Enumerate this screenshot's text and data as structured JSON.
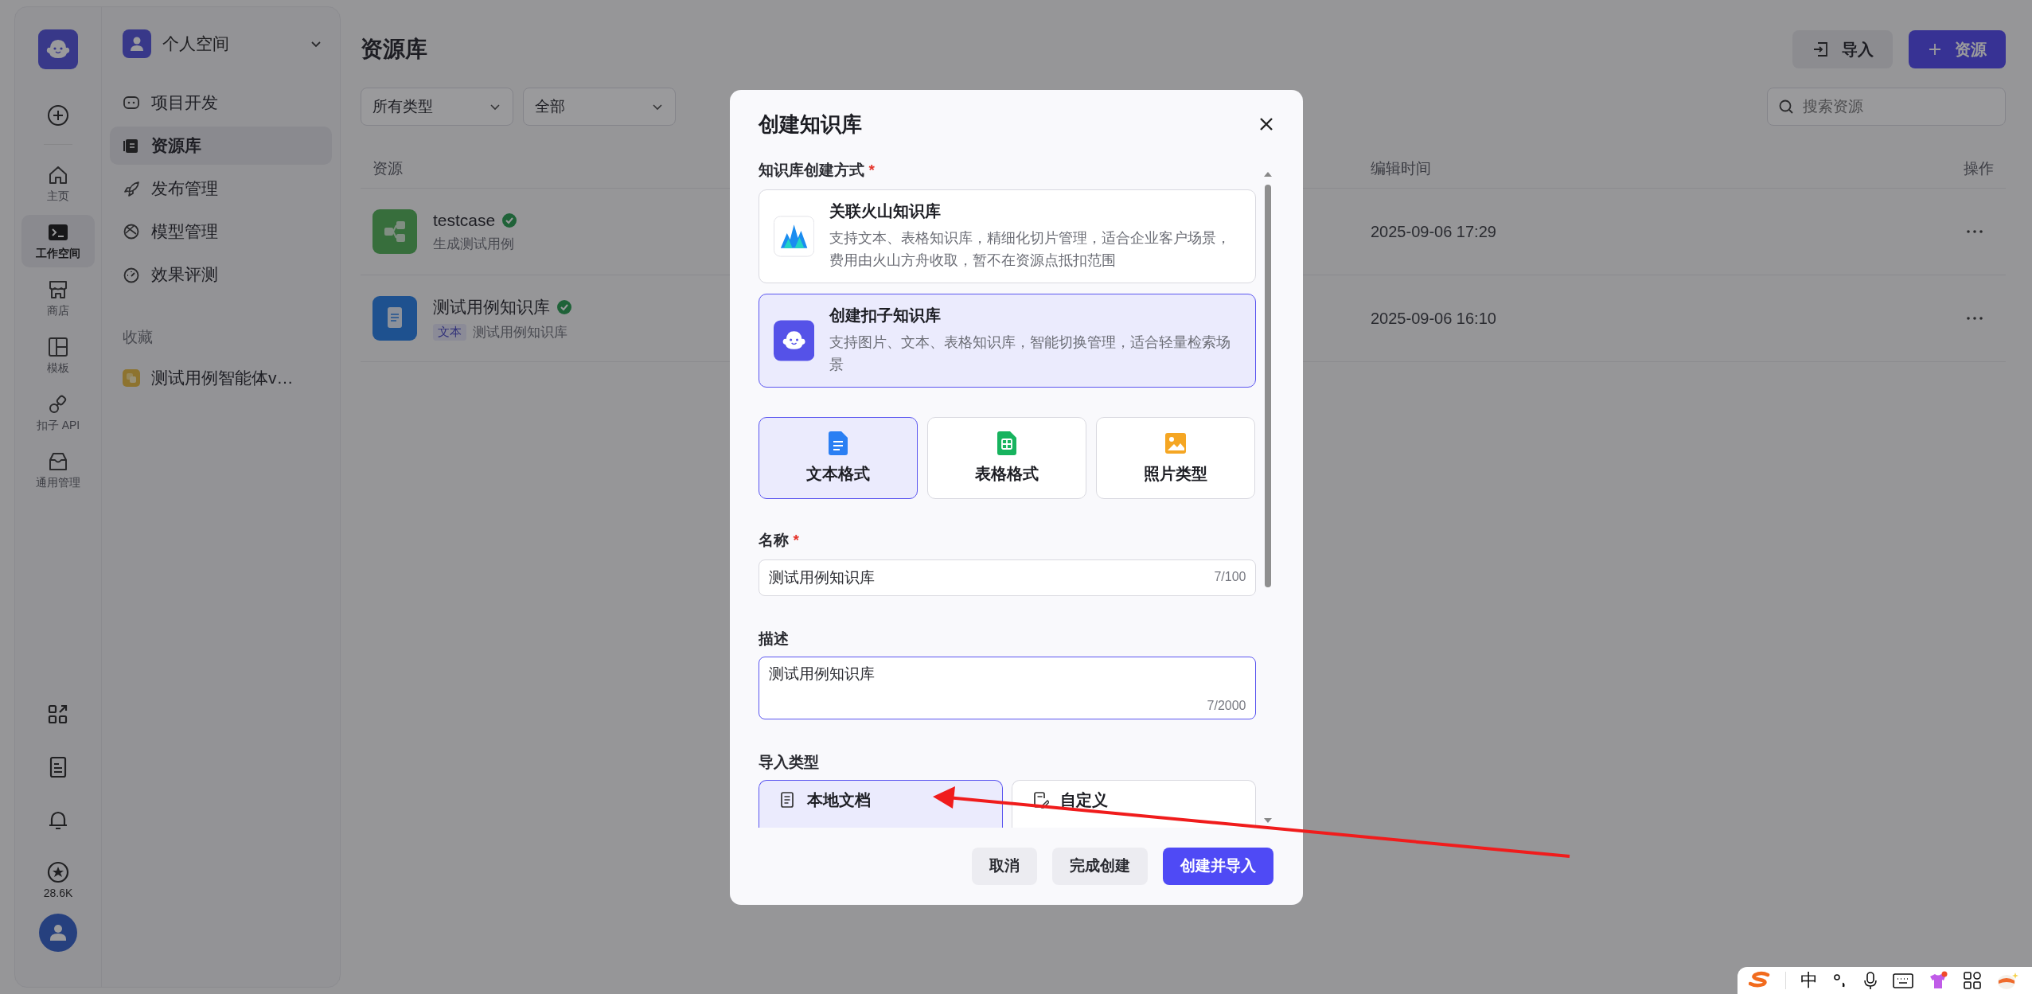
{
  "rail": {
    "items": [
      {
        "label": "主页",
        "selected": false
      },
      {
        "label": "工作空间",
        "selected": true
      },
      {
        "label": "商店",
        "selected": false
      },
      {
        "label": "模板",
        "selected": false
      },
      {
        "label": "扣子 API",
        "selected": false
      },
      {
        "label": "通用管理",
        "selected": false
      }
    ],
    "stars_count": "28.6K"
  },
  "space": {
    "name": "个人空间"
  },
  "nav": {
    "items": [
      {
        "label": "项目开发",
        "selected": false
      },
      {
        "label": "资源库",
        "selected": true
      },
      {
        "label": "发布管理",
        "selected": false
      },
      {
        "label": "模型管理",
        "selected": false
      },
      {
        "label": "效果评测",
        "selected": false
      }
    ]
  },
  "favorites": {
    "title": "收藏",
    "items": [
      {
        "label": "测试用例智能体v…"
      }
    ]
  },
  "page": {
    "title": "资源库",
    "actions": [
      {
        "label": "导入",
        "kind": "secondary"
      },
      {
        "label": "资源",
        "kind": "primary"
      }
    ],
    "filters": [
      "所有类型",
      "全部"
    ],
    "search": {
      "placeholder": "搜索资源"
    }
  },
  "table": {
    "columns": [
      "资源",
      "编辑时间",
      "操作"
    ],
    "rows": [
      {
        "name": "testcase",
        "verified": true,
        "kind": "workflow",
        "description": "生成测试用例",
        "edited": "2025-09-06 17:29"
      },
      {
        "name": "测试用例知识库",
        "verified": true,
        "kind": "knowledge",
        "tag": "文本",
        "description": "测试用例知识库",
        "edited": "2025-09-06 16:10"
      }
    ]
  },
  "dialog": {
    "title": "创建知识库",
    "method_label": "知识库创建方式",
    "method_required_mark": "*",
    "methods": [
      {
        "kind": "volcano",
        "title": "关联火山知识库",
        "description": "支持文本、表格知识库，精细化切片管理，适合企业客户场景，费用由火山方舟收取，暂不在资源点抵扣范围",
        "selected": false
      },
      {
        "kind": "coze",
        "title": "创建扣子知识库",
        "description": "支持图片、文本、表格知识库，智能切换管理，适合轻量检索场景",
        "selected": true
      }
    ],
    "formats": [
      {
        "kind": "text",
        "label": "文本格式",
        "selected": true
      },
      {
        "kind": "table",
        "label": "表格格式",
        "selected": false
      },
      {
        "kind": "image",
        "label": "照片类型",
        "selected": false
      }
    ],
    "name_field": {
      "label": "名称",
      "required_mark": "*",
      "value": "测试用例知识库",
      "counter": "7/100",
      "focused": false
    },
    "description_field": {
      "label": "描述",
      "value": "测试用例知识库",
      "counter": "7/2000",
      "focused": true
    },
    "import_label": "导入类型",
    "import_types": [
      {
        "kind": "local",
        "label": "本地文档",
        "selected": true
      },
      {
        "kind": "custom",
        "label": "自定义",
        "selected": false
      }
    ],
    "buttons": [
      {
        "label": "取消",
        "kind": "secondary"
      },
      {
        "label": "完成创建",
        "kind": "secondary"
      },
      {
        "label": "创建并导入",
        "kind": "primary"
      }
    ]
  },
  "ime_toolbar": {
    "mode": "中"
  }
}
